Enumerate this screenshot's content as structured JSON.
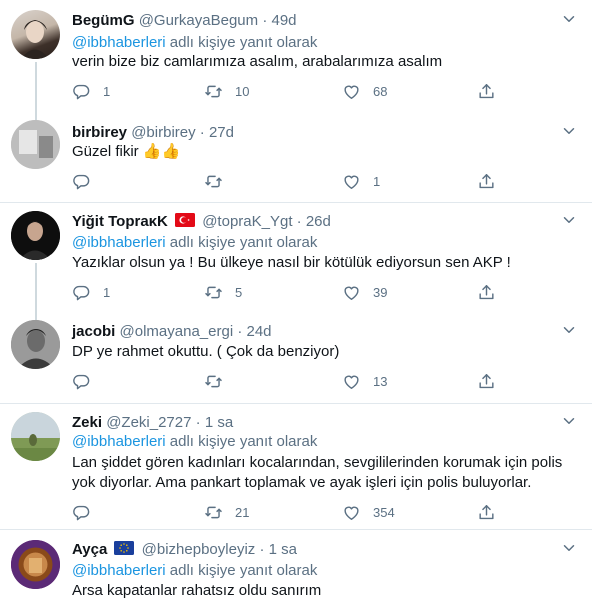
{
  "tweets": [
    {
      "name": "BegümG",
      "handle": "@GurkayaBegum",
      "time": "49d",
      "reply_mention": "@ibbhaberleri",
      "reply_suffix": " adlı kişiye yanıt olarak",
      "text": "verin bize biz camlarımıza asalım, arabalarımıza asalım",
      "replies": "1",
      "retweets": "10",
      "likes": "68"
    },
    {
      "name": "birbirey",
      "handle": "@birbirey",
      "time": "27d",
      "text": "Güzel fikir 👍👍",
      "replies": "",
      "retweets": "",
      "likes": "1"
    },
    {
      "name": "Yiğit TopraκK",
      "handle": "@topraK_Ygt",
      "time": "26d",
      "reply_mention": "@ibbhaberleri",
      "reply_suffix": " adlı kişiye yanıt olarak",
      "text": "Yazıklar olsun ya ! Bu ülkeye nasıl bir kötülük ediyorsun sen AKP !",
      "replies": "1",
      "retweets": "5",
      "likes": "39"
    },
    {
      "name": "jacobi",
      "handle": "@olmayana_ergi",
      "time": "24d",
      "text": "DP ye rahmet okuttu. ( Çok da benziyor)",
      "replies": "",
      "retweets": "",
      "likes": "13"
    },
    {
      "name": "Zeki",
      "handle": "@Zeki_2727",
      "time": "1 sa",
      "reply_mention": "@ibbhaberleri",
      "reply_suffix": " adlı kişiye yanıt olarak",
      "text_line1": "Lan şiddet gören kadınları kocalarından, sevgililerinden korumak için polis",
      "text_line2": "yok diyorlar. Ama pankart toplamak ve ayak işleri için polis buluyorlar.",
      "replies": "",
      "retweets": "21",
      "likes": "354"
    },
    {
      "name": "Ayça",
      "handle": "@bizhepboyleyiz",
      "time": "1 sa",
      "reply_mention": "@ibbhaberleri",
      "reply_suffix": " adlı kişiye yanıt olarak",
      "text": "Arsa kapatanlar rahatsız oldu sanırım"
    }
  ],
  "dot": "·",
  "colors": {
    "accent": "#1b95e0",
    "muted": "#5b7083",
    "divider": "#e1e8ed"
  }
}
